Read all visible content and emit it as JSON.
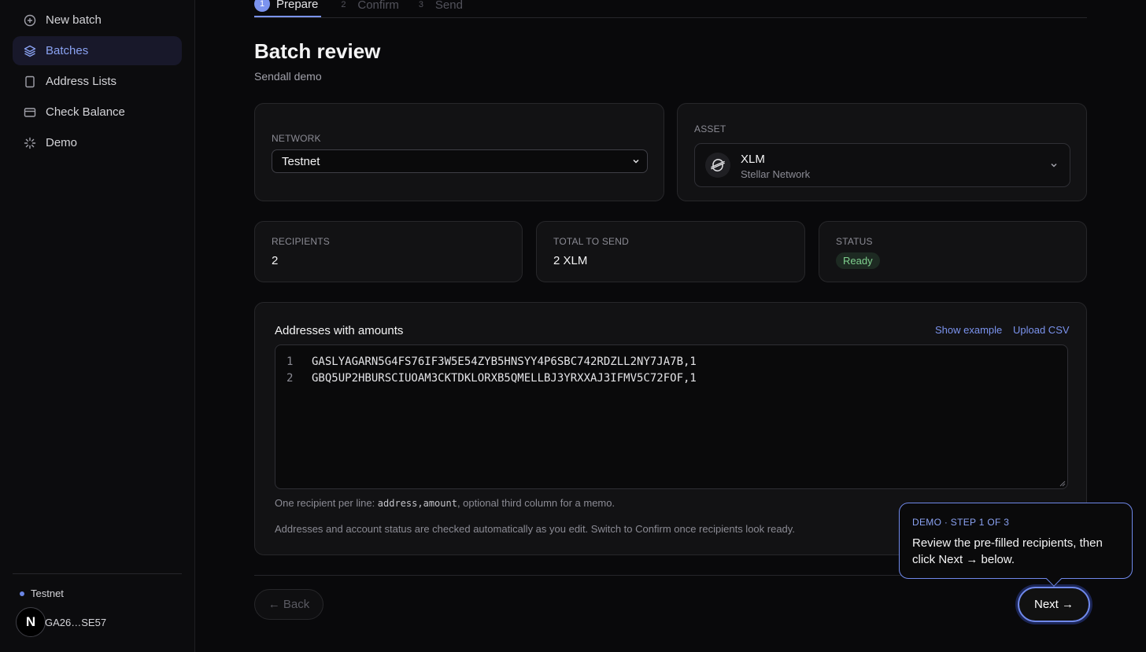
{
  "sidebar": {
    "items": [
      {
        "label": "New batch",
        "icon": "plus-circle-icon"
      },
      {
        "label": "Batches",
        "icon": "layers-icon"
      },
      {
        "label": "Address Lists",
        "icon": "book-icon"
      },
      {
        "label": "Check Balance",
        "icon": "wallet-icon"
      },
      {
        "label": "Demo",
        "icon": "sparkle-icon"
      }
    ],
    "network": "Testnet",
    "account_initial": "N",
    "account_address": "GA26…SE57"
  },
  "steps": [
    {
      "num": "1",
      "label": "Prepare"
    },
    {
      "num": "2",
      "label": "Confirm"
    },
    {
      "num": "3",
      "label": "Send"
    }
  ],
  "header": {
    "title": "Batch review",
    "subtitle": "Sendall demo"
  },
  "network_card": {
    "label": "Network",
    "value": "Testnet"
  },
  "asset_card": {
    "label": "Asset",
    "code": "XLM",
    "name": "Stellar Network"
  },
  "stats": {
    "recipients_label": "Recipients",
    "recipients_value": "2",
    "total_label": "Total to send",
    "total_value": "2 XLM",
    "status_label": "Status",
    "status_value": "Ready"
  },
  "addresses": {
    "title": "Addresses with amounts",
    "show_example": "Show example",
    "upload_csv": "Upload CSV",
    "lines": [
      {
        "n": "1",
        "text": "GASLYAGARN5G4FS76IF3W5E54ZYB5HNSYY4P6SBC742RDZLL2NY7JA7B,1"
      },
      {
        "n": "2",
        "text": "GBQ5UP2HBURSCIUOAM3CKTDKLORXB5QMELLBJ3YRXXAJ3IFMV5C72FOF,1"
      }
    ],
    "hint_prefix": "One recipient per line: ",
    "hint_code": "address,amount",
    "hint_suffix": ", optional third column for a memo.",
    "hint2": "Addresses and account status are checked automatically as you edit. Switch to Confirm once recipients look ready."
  },
  "footer": {
    "back": "← Back",
    "next": "Next →"
  },
  "tooltip": {
    "kicker": "DEMO · STEP 1 OF 3",
    "body": "Review the pre-filled recipients, then click Next → below."
  },
  "colors": {
    "accent": "#7b93ee",
    "status_ready": "#7fd08e",
    "background": "#09090b"
  }
}
